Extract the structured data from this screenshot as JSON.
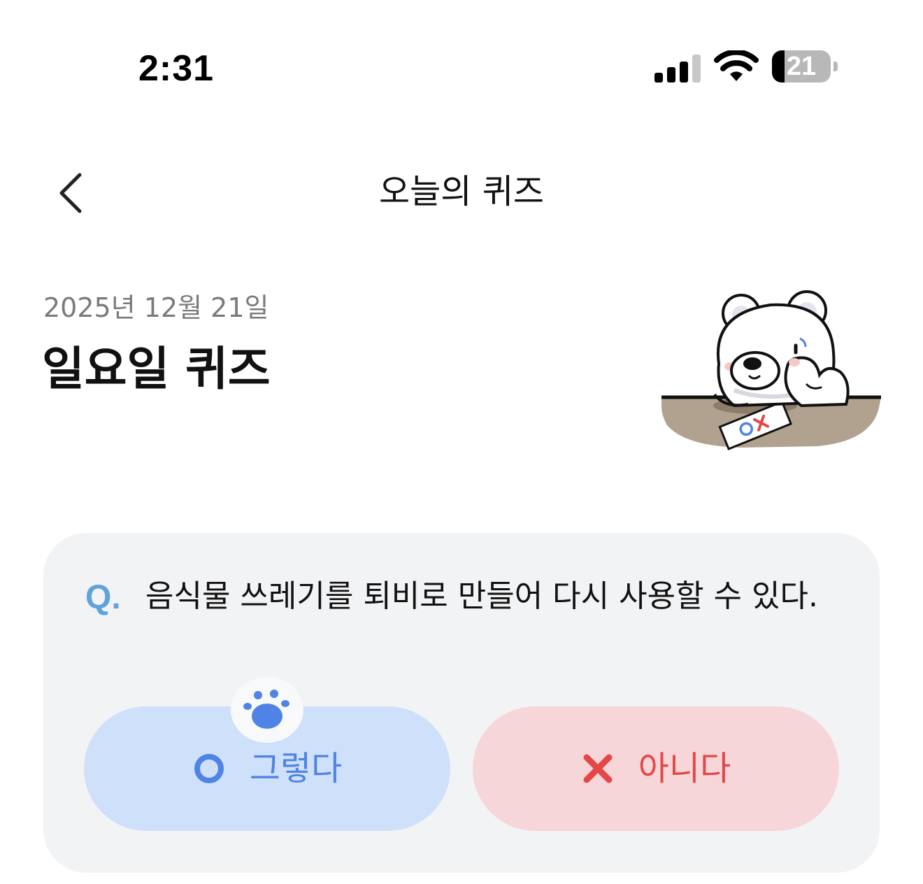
{
  "status_bar": {
    "time": "2:31",
    "battery_level": "21",
    "battery_fraction": 0.21,
    "signal_bars_active": 3,
    "signal_bars_total": 4
  },
  "nav": {
    "title": "오늘의 퀴즈",
    "back_icon": "chevron-left-icon"
  },
  "header": {
    "date": "2025년 12월 21일",
    "title": "일요일 퀴즈",
    "illustration": "bear-at-desk-illustration"
  },
  "quiz": {
    "prefix": "Q.",
    "question": "음식물 쓰레기를 퇴비로 만들어 다시 사용할 수 있다.",
    "answers": [
      {
        "label": "그렇다",
        "icon": "o-icon",
        "color": "#4f83e5",
        "bg": "#cfe0fb"
      },
      {
        "label": "아니다",
        "icon": "x-icon",
        "color": "#e44747",
        "bg": "#f7d6d9"
      }
    ],
    "pointer_icon": "paw-icon"
  },
  "colors": {
    "accent_blue": "#4f83e5",
    "accent_red": "#e44747",
    "question_prefix": "#5fa3dc",
    "card_bg": "#f2f3f5"
  }
}
